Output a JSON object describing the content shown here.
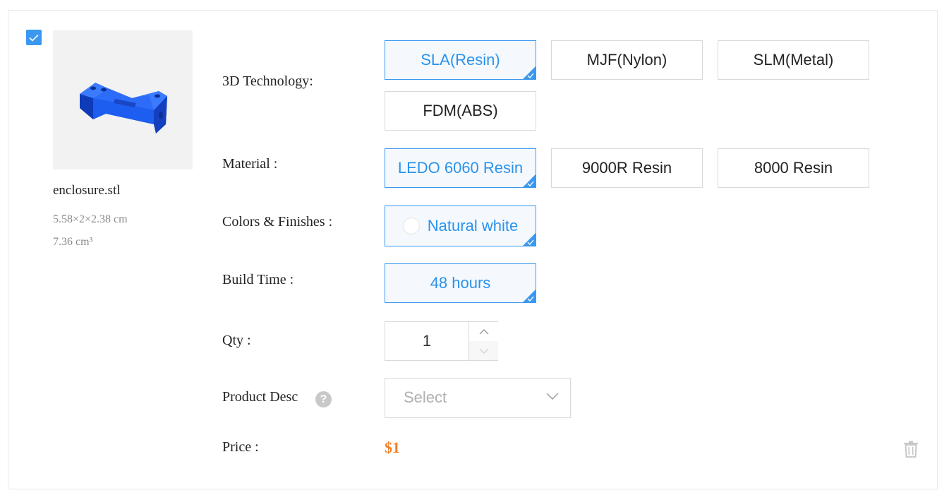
{
  "item": {
    "checked": true,
    "filename": "enclosure.stl",
    "dimensions": "5.58×2×2.38 cm",
    "volume": "7.36 cm³"
  },
  "labels": {
    "technology": "3D Technology:",
    "material": "Material :",
    "colors": "Colors & Finishes :",
    "build_time": "Build Time :",
    "qty": "Qty :",
    "product_desc": "Product Desc",
    "price": "Price :"
  },
  "technology_options": [
    {
      "label": "SLA(Resin)",
      "selected": true
    },
    {
      "label": "MJF(Nylon)",
      "selected": false
    },
    {
      "label": "SLM(Metal)",
      "selected": false
    },
    {
      "label": "FDM(ABS)",
      "selected": false
    }
  ],
  "material_options": [
    {
      "label": "LEDO 6060 Resin",
      "selected": true
    },
    {
      "label": "9000R Resin",
      "selected": false
    },
    {
      "label": "8000 Resin",
      "selected": false
    }
  ],
  "color_option": {
    "label": "Natural white",
    "selected": true,
    "swatch": "#ffffff"
  },
  "build_time_option": {
    "label": "48 hours",
    "selected": true
  },
  "qty": {
    "value": "1"
  },
  "product_desc": {
    "placeholder": "Select",
    "help_glyph": "?"
  },
  "price": {
    "value": "$1"
  },
  "colors": {
    "accent": "#3a98f0",
    "price": "#f5812a",
    "model": "#1c5ee8"
  },
  "icons": {
    "checkbox": "check-icon",
    "qty_up": "chevron-up-icon",
    "qty_down": "chevron-down-icon",
    "select": "chevron-down-icon",
    "help": "question-icon",
    "delete": "trash-icon"
  }
}
